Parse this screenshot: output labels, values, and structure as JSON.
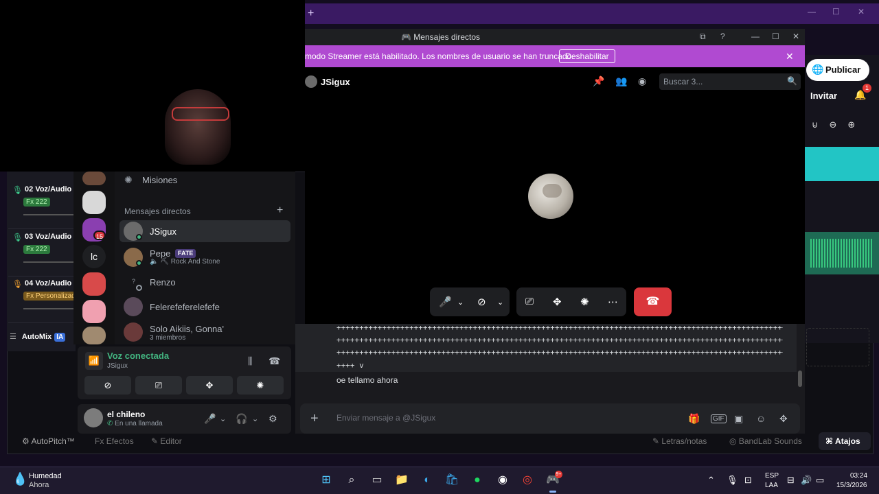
{
  "bandlab": {
    "tracks": [
      {
        "number": "02",
        "name": "Voz/Audio",
        "fx": "Fx 222"
      },
      {
        "number": "03",
        "name": "Voz/Audio",
        "fx": "Fx 222"
      },
      {
        "number": "04",
        "name": "Voz/Audio",
        "fx": "Fx Personalizad"
      }
    ],
    "automix": "AutoMix",
    "automix_badge": "IA",
    "publish": "Publicar",
    "invite": "Invitar",
    "notif_count": "1",
    "bottom": {
      "autopitch": "AutoPitch™",
      "effects": "Efectos",
      "editor": "Editor",
      "lyrics": "Letras/notas",
      "sounds": "BandLab Sounds",
      "shortcuts": "Atajos"
    },
    "fx_prefix": "Fx"
  },
  "discord": {
    "window_title": "Mensajes directos",
    "streamer_notice": "modo Streamer está habilitado. Los nombres de usuario se han truncado.",
    "disable_button": "Deshabilitar",
    "call": {
      "name": "JSigux",
      "search_placeholder": "Buscar 3..."
    },
    "messages": {
      "plus_line": "++++++++++++++++++++++++++++++++++++++++++++++++++++++++++++++++++++++++++++++++++++++++++++++++++++++++++++++++",
      "tail": "++++ v",
      "text": "oe tellamo ahora"
    },
    "composer_placeholder": "Enviar mensaje a @JSigux",
    "sidebar": {
      "quests": "Misiones",
      "dm_header": "Mensajes directos",
      "lc": "lc",
      "server_badge": "15",
      "dms": [
        {
          "name": "JSigux",
          "sub": ""
        },
        {
          "name": "Pepe",
          "badge": "FATE",
          "sub": "Rock And Stone"
        },
        {
          "name": "Renzo",
          "sub": ""
        },
        {
          "name": "Felerefeferelefefe",
          "sub": ""
        },
        {
          "name": "Solo Aikiis, Gonna'",
          "sub": "3 miembros"
        }
      ]
    },
    "voice": {
      "status": "Voz conectada",
      "channel": "JSigux"
    },
    "user": {
      "name": "el chileno",
      "status": "En una llamada"
    }
  },
  "taskbar": {
    "weather_name": "Humedad",
    "weather_time": "Ahora",
    "lang1": "ESP",
    "lang2": "LAA",
    "time": "03:24",
    "date": "15/3/2026",
    "discord_badge": "9+"
  },
  "colors": {
    "streamer_bar": "#b04ad1",
    "end_call": "#da373c",
    "voice_green": "#43b581"
  }
}
